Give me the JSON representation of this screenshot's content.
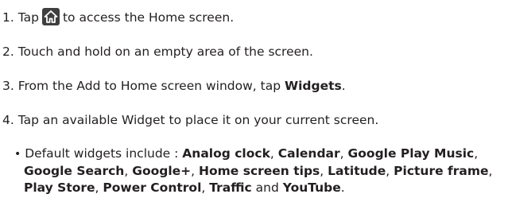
{
  "steps": {
    "s1": {
      "prefix": "1. Tap",
      "icon": "home-key-icon",
      "suffix": "to access the Home screen."
    },
    "s2": {
      "text": "2. Touch and hold on an empty area of the screen."
    },
    "s3": {
      "prefix": "3. From the Add to Home screen window, tap",
      "bold": "Widgets",
      "suffix": "."
    },
    "s4": {
      "text": "4. Tap an available Widget to place it on your current screen."
    }
  },
  "bullet": {
    "marker": "•",
    "intro": "Default widgets include :",
    "widgets": {
      "w1": "Analog clock",
      "w2": "Calendar",
      "w3": "Google Play Music",
      "w4": "Google Search",
      "w5": "Google+",
      "w6": "Home screen tips",
      "w7": "Latitude",
      "w8": "Picture frame",
      "w9": "Play Store",
      "w10": "Power Control",
      "w11": "Traffic",
      "w12": "YouTube"
    },
    "and_word": "and",
    "comma": ",",
    "end": "."
  },
  "colors": {
    "text": "#231f20",
    "icon_bg": "#3f3f3f",
    "icon_fg": "#ffffff"
  }
}
